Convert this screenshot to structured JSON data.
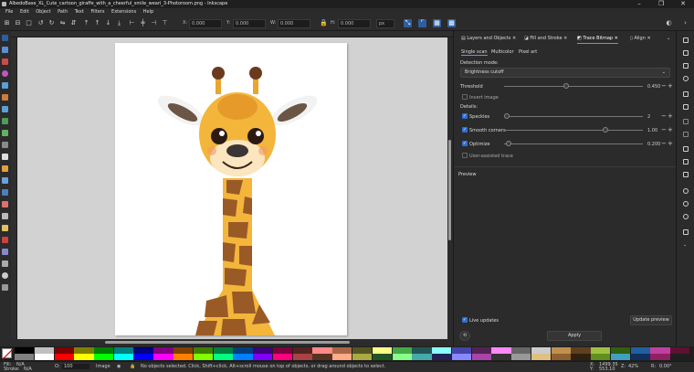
{
  "window": {
    "title": "AlbedoBase_XL_Cute_cartoon_giraffe_with_a_cheerful_smile_weari_3-Photoroom.png - Inkscape",
    "minimize": "–",
    "maximize": "❐",
    "close": "✕"
  },
  "menu": [
    "Edit",
    "Object",
    "Path",
    "Text",
    "Filters",
    "Extensions",
    "Help"
  ],
  "toolbar": {
    "x_label": "X:",
    "x_value": "0.000",
    "y_label": "Y:",
    "y_value": "0.000",
    "w_label": "W:",
    "w_value": "0.000",
    "h_label": "H:",
    "h_value": "0.000",
    "unit": "px"
  },
  "panel": {
    "tabs": [
      "Layers and Objects",
      "Fill and Stroke",
      "Trace Bitmap",
      "Align"
    ],
    "active_tab": "Trace Bitmap",
    "subtabs": [
      "Single scan",
      "Multicolor",
      "Pixel art"
    ],
    "detection_mode_label": "Detection mode:",
    "detection_mode_value": "Brightness cutoff",
    "threshold_label": "Threshold",
    "threshold_value": "0.450",
    "threshold_fraction": 0.45,
    "invert_label": "Invert image",
    "details_label": "Details:",
    "speckles_label": "Speckles",
    "speckles_value": "2",
    "smooth_label": "Smooth corners",
    "smooth_value": "1.00",
    "optimize_label": "Optimize",
    "optimize_value": "0.200",
    "user_trace_label": "User-assisted trace",
    "preview_label": "Preview",
    "live_updates_label": "Live updates",
    "update_preview_label": "Update preview",
    "apply_label": "Apply"
  },
  "status": {
    "fill_label": "Fill:",
    "fill_value": "N/A",
    "stroke_label": "Stroke:",
    "stroke_value": "N/A",
    "opacity_label": "O:",
    "opacity_value": "100",
    "layer_label": "Image",
    "message": "No objects selected. Click, Shift+click, Alt+scroll mouse on top of objects, or drag around objects to select.",
    "x_label": "X:",
    "x_value": "1499.35",
    "y_label": "Y:",
    "y_value": "553.10",
    "zoom_label": "Z:",
    "zoom_value": "42%",
    "rotation_label": "R:",
    "rotation_value": "0.00°"
  },
  "colors": {
    "accent": "#2f5e9e",
    "giraffe_yellow": "#f3b63b",
    "giraffe_brown": "#9a5a26"
  },
  "palette_colors": [
    "#000000",
    "#808080",
    "#c0c0c0",
    "#ffffff",
    "#800000",
    "#ff0000",
    "#808000",
    "#ffff00",
    "#008000",
    "#00ff00",
    "#008080",
    "#00ffff",
    "#000080",
    "#0000ff",
    "#800080",
    "#ff00ff",
    "#7f3f00",
    "#ff7f00",
    "#3f7f00",
    "#7fff00",
    "#007f3f",
    "#00ff7f",
    "#003f7f",
    "#007fff",
    "#3f007f",
    "#7f00ff",
    "#7f003f",
    "#ff007f",
    "#552222",
    "#aa4444",
    "#ff8888",
    "#553322",
    "#aa6644",
    "#ffaa88",
    "#555522",
    "#aaaa44",
    "#ffff88",
    "#225522",
    "#44aa44",
    "#88ff88",
    "#225555",
    "#44aaaa",
    "#88ffff",
    "#222255",
    "#4444aa",
    "#8888ff",
    "#552255",
    "#aa44aa",
    "#ff88ff",
    "#333333",
    "#666666",
    "#999999",
    "#cccccc",
    "#e0c080",
    "#c09050",
    "#906030",
    "#604020",
    "#302010",
    "#a0c040",
    "#609020",
    "#306010",
    "#40a0c0",
    "#2060a0",
    "#103060",
    "#c040a0",
    "#902060",
    "#601030"
  ]
}
